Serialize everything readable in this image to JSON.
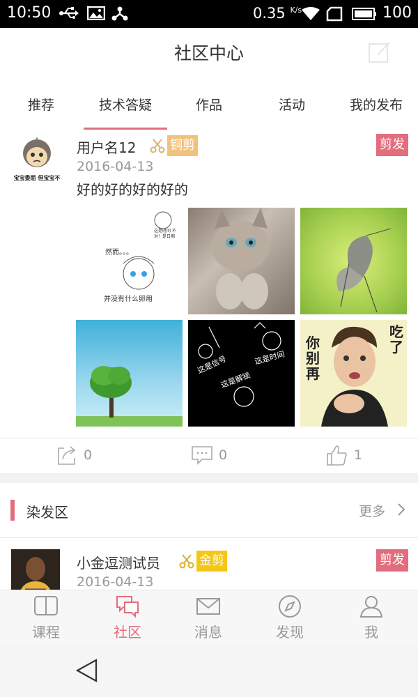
{
  "status_bar": {
    "time": "10:50",
    "net_speed": "0.35",
    "net_unit": "K/s",
    "battery": "100"
  },
  "header": {
    "title": "社区中心",
    "edit_icon": "edit-icon"
  },
  "tabs": [
    {
      "label": "推荐"
    },
    {
      "label": "技术答疑",
      "active": true
    },
    {
      "label": "作品"
    },
    {
      "label": "活动"
    },
    {
      "label": "我的发布"
    }
  ],
  "post": {
    "username": "用户名12",
    "rank": "铜剪",
    "rank_color": "#f1c27c",
    "tag": "剪发",
    "date": "2016-04-13",
    "content": "好的好的好的好的",
    "avatar_caption": "宝宝委屈 但宝宝不说",
    "photo_captions": {
      "p1_top": "这是时间 不对！是日期",
      "p1_mid": "然而。。。",
      "p1_bottom": "并没有什么卵用",
      "p5_a": "这是信号",
      "p5_b": "这是时间",
      "p5_c": "这是解锁",
      "p6_left": "你别再",
      "p6_right": "吃了"
    },
    "actions": {
      "share_count": "0",
      "comment_count": "0",
      "like_count": "1"
    }
  },
  "section": {
    "title": "染发区",
    "more": "更多"
  },
  "post2": {
    "username": "小金逗测试员",
    "rank": "金剪",
    "rank_color": "#f5c518",
    "tag": "剪发",
    "date": "2016-04-13"
  },
  "bottom_nav": [
    {
      "label": "课程",
      "icon": "book-icon"
    },
    {
      "label": "社区",
      "icon": "chat-bubbles-icon",
      "active": true
    },
    {
      "label": "消息",
      "icon": "envelope-icon"
    },
    {
      "label": "发现",
      "icon": "compass-icon"
    },
    {
      "label": "我",
      "icon": "person-icon"
    }
  ],
  "colors": {
    "accent": "#e26d7e",
    "inactive": "#999999"
  }
}
